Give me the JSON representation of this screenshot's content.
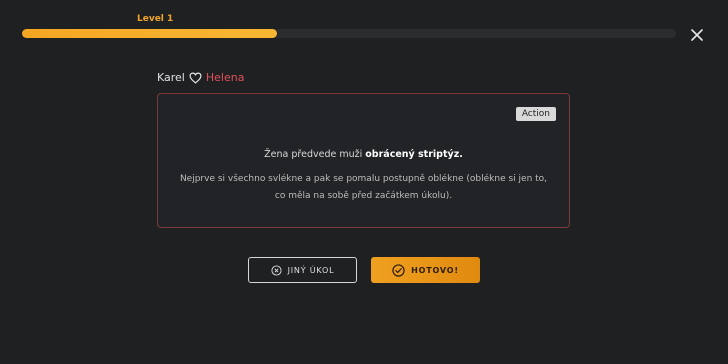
{
  "progress": {
    "label": "Level 1",
    "percent": 39,
    "color": "#f5a623"
  },
  "close_icon": "close-icon",
  "players": {
    "a": "Karel",
    "b": "Helena",
    "heart_icon": "heart-outline-icon"
  },
  "task": {
    "badge": "Action",
    "line_prefix": "Žena předvede muži ",
    "line_bold": "obrácený striptýz.",
    "detail": "Nejprve si všechno svlékne a pak se pomalu postupně oblékne (oblékne si jen to, co měla na sobě před začátkem úkolu)."
  },
  "buttons": {
    "other_label": "JINÝ ÚKOL",
    "done_label": "HOTOVO!"
  }
}
